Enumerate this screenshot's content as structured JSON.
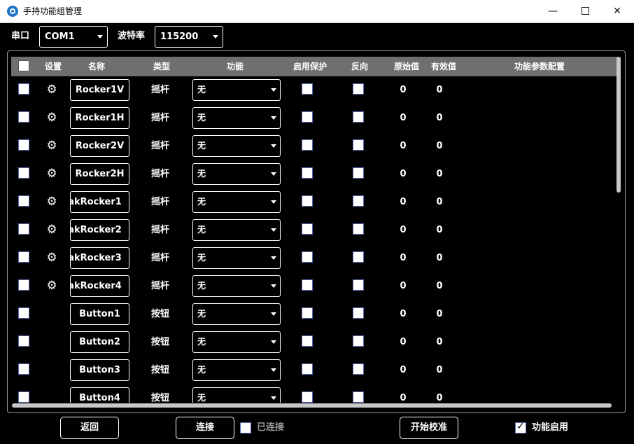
{
  "window": {
    "title": "手持功能组管理",
    "minimize": "—",
    "close": "✕"
  },
  "top": {
    "port_label": "串口",
    "port_value": "COM1",
    "baud_label": "波特率",
    "baud_value": "115200"
  },
  "table": {
    "headers": {
      "settings": "设置",
      "name": "名称",
      "type": "类型",
      "function": "功能",
      "protect": "启用保护",
      "reverse": "反向",
      "raw": "原始值",
      "effective": "有效值",
      "params": "功能参数配置"
    },
    "rows": [
      {
        "name": "Rocker1V",
        "type": "摇杆",
        "function": "无",
        "raw": "0",
        "effective": "0",
        "gear": true,
        "clipped": false
      },
      {
        "name": "Rocker1H",
        "type": "摇杆",
        "function": "无",
        "raw": "0",
        "effective": "0",
        "gear": true,
        "clipped": false
      },
      {
        "name": "Rocker2V",
        "type": "摇杆",
        "function": "无",
        "raw": "0",
        "effective": "0",
        "gear": true,
        "clipped": false
      },
      {
        "name": "Rocker2H",
        "type": "摇杆",
        "function": "无",
        "raw": "0",
        "effective": "0",
        "gear": true,
        "clipped": false
      },
      {
        "name": "akRocker1",
        "type": "摇杆",
        "function": "无",
        "raw": "0",
        "effective": "0",
        "gear": true,
        "clipped": true
      },
      {
        "name": "akRocker2",
        "type": "摇杆",
        "function": "无",
        "raw": "0",
        "effective": "0",
        "gear": true,
        "clipped": true
      },
      {
        "name": "akRocker3",
        "type": "摇杆",
        "function": "无",
        "raw": "0",
        "effective": "0",
        "gear": true,
        "clipped": true
      },
      {
        "name": "akRocker4",
        "type": "摇杆",
        "function": "无",
        "raw": "0",
        "effective": "0",
        "gear": true,
        "clipped": true
      },
      {
        "name": "Button1",
        "type": "按钮",
        "function": "无",
        "raw": "0",
        "effective": "0",
        "gear": false,
        "clipped": false
      },
      {
        "name": "Button2",
        "type": "按钮",
        "function": "无",
        "raw": "0",
        "effective": "0",
        "gear": false,
        "clipped": false
      },
      {
        "name": "Button3",
        "type": "按钮",
        "function": "无",
        "raw": "0",
        "effective": "0",
        "gear": false,
        "clipped": false
      },
      {
        "name": "Button4",
        "type": "按钮",
        "function": "无",
        "raw": "0",
        "effective": "0",
        "gear": false,
        "clipped": false
      }
    ]
  },
  "bottom": {
    "back": "返回",
    "connect": "连接",
    "connected_label": "已连接",
    "calibrate": "开始校准",
    "enable_label": "功能启用",
    "enable_checked": true,
    "connected_checked": false
  },
  "colors": {
    "header_bg": "#6f6f6f",
    "checkbox_border": "#5c6db8",
    "disabled_text": "#9a9a9a"
  }
}
